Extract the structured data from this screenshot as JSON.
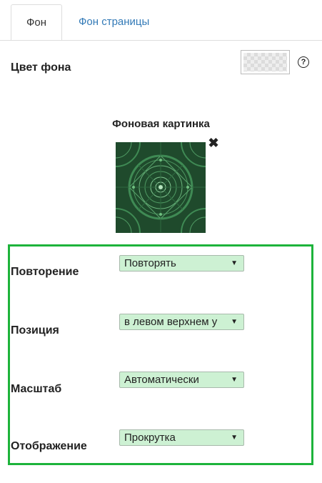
{
  "tabs": [
    {
      "label": "Фон",
      "active": true
    },
    {
      "label": "Фон страницы",
      "active": false
    }
  ],
  "bg_color": {
    "label": "Цвет фона",
    "help_icon": "question-circle-icon"
  },
  "bg_image": {
    "title": "Фоновая картинка",
    "remove_icon": "close-icon"
  },
  "settings": {
    "repeat": {
      "label": "Повторение",
      "value": "Повторять"
    },
    "position": {
      "label": "Позиция",
      "value": "в левом верхнем у"
    },
    "scale": {
      "label": "Масштаб",
      "value": "Автоматически"
    },
    "display": {
      "label": "Отображение",
      "value": "Прокрутка"
    }
  },
  "colors": {
    "accent_border": "#1db33b",
    "select_bg": "#cdf1d3",
    "link": "#337ab7"
  }
}
